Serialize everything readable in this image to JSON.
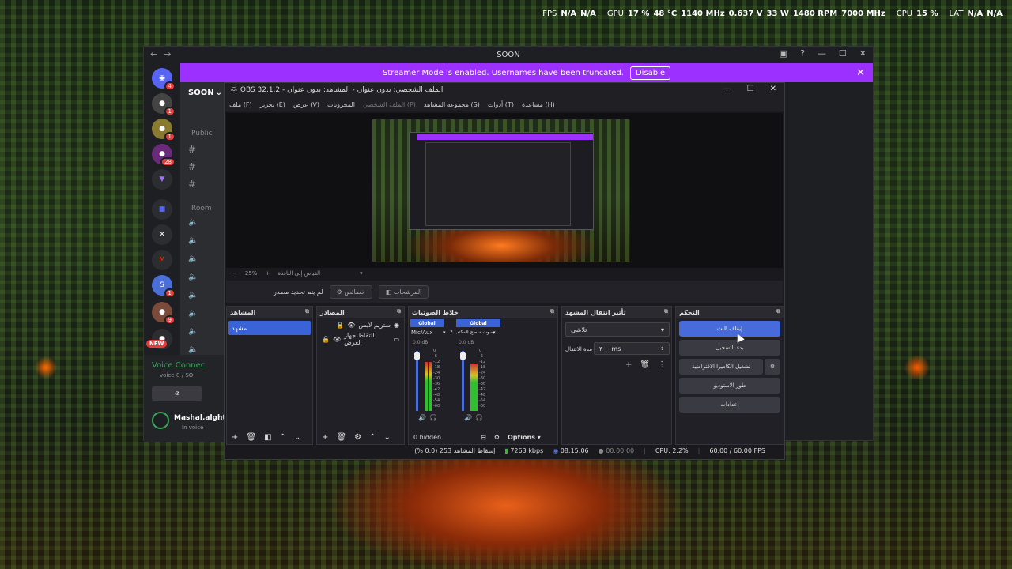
{
  "overlay": {
    "fps_label": "FPS",
    "fps_value1": "N/A",
    "fps_value2": "N/A",
    "gpu_label": "GPU",
    "gpu_usage": "17 %",
    "gpu_temp": "48 °C",
    "gpu_clock": "1140 MHz",
    "gpu_volt": "0.637 V",
    "gpu_power": "33 W",
    "gpu_fan": "1480 RPM",
    "gpu_mem": "7000 MHz",
    "cpu_label": "CPU",
    "cpu_usage": "15 %",
    "lat_label": "LAT",
    "lat_value1": "N/A",
    "lat_value2": "N/A"
  },
  "discord": {
    "title": "SOON",
    "server_name": "SOON",
    "banner_text": "Streamer Mode is enabled. Usernames have been truncated.",
    "banner_button": "Disable",
    "server_badges": [
      "4",
      "1",
      "1",
      "28",
      "1",
      "9"
    ],
    "new_label": "NEW",
    "category_public": "Public",
    "category_room": "Room",
    "voice_connected": "Voice Connec",
    "voice_channel": "voice-8 / SO",
    "user_name": "Mashal.alghta",
    "user_status": "In voice"
  },
  "obs": {
    "title": "OBS 32.1.2 - الملف الشخصي: بدون عنوان - المشاهد: بدون عنوان",
    "menu": [
      "ملف (F)",
      "تحرير (E)",
      "عرض (V)",
      "المحزونات",
      "الملف الشخصي (P)",
      "مجموعة المشاهد (S)",
      "أدوات (T)",
      "مساعدة (H)"
    ],
    "zoom": "25%",
    "scale_label": "القياس إلى النافذة",
    "no_source_selected": "لم يتم تحديد مصدر",
    "properties_button": "خصائص",
    "filters_button": "المرشحات",
    "docks": {
      "scenes": {
        "title": "المشاهد",
        "items": [
          "مشهد"
        ]
      },
      "sources": {
        "title": "المصادر",
        "items": [
          "ستريم لابس",
          "التقاط جهاز العرض"
        ]
      },
      "mixer": {
        "title": "خلاط الصوتيات",
        "channels": [
          {
            "tag": "Global",
            "name": "Mic/Aux",
            "db": "0.0 dB"
          },
          {
            "tag": "Global",
            "name": "صوت سطح المكتب 2",
            "db": "0.0 dB"
          }
        ],
        "ticks": [
          "0",
          "-6",
          "-12",
          "-18",
          "-24",
          "-30",
          "-36",
          "-42",
          "-48",
          "-54",
          "-60"
        ],
        "hidden": "0 hidden",
        "options": "Options"
      },
      "transitions": {
        "title": "تأثير انتقال المشهد",
        "selected": "تلاشي",
        "duration_label": "مدة الانتقال",
        "duration_value": "٣٠٠ ms"
      },
      "controls": {
        "title": "التحكم",
        "buttons": [
          "إيقاف البث",
          "بدء التسجيل",
          "تشغيل الكاميرا الافتراضية",
          "طور الاستوديو",
          "إعدادات"
        ]
      }
    },
    "status": {
      "dropped": "إسقاط المشاهد 253 (0.0 %)",
      "bitrate": "7263 kbps",
      "stream_time": "08:15:06",
      "rec_time": "00:00:00",
      "cpu": "CPU: 2.2%",
      "fps": "60.00 / 60.00 FPS"
    }
  }
}
